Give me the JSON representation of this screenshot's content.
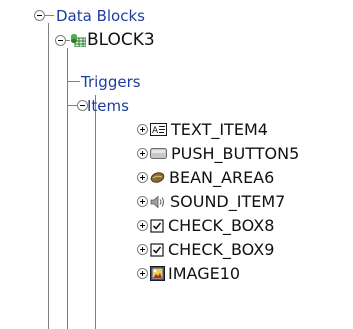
{
  "tree": {
    "data_blocks": "Data Blocks",
    "block": "BLOCK3",
    "triggers": "Triggers",
    "items_node": "Items",
    "items": [
      {
        "label": "TEXT_ITEM4",
        "icon": "text-item-icon"
      },
      {
        "label": "PUSH_BUTTON5",
        "icon": "push-button-icon"
      },
      {
        "label": "BEAN_AREA6",
        "icon": "bean-area-icon"
      },
      {
        "label": "SOUND_ITEM7",
        "icon": "sound-item-icon"
      },
      {
        "label": "CHECK_BOX8",
        "icon": "check-box-icon"
      },
      {
        "label": "CHECK_BOX9",
        "icon": "check-box-icon"
      },
      {
        "label": "IMAGE10",
        "icon": "image-item-icon"
      }
    ]
  },
  "colors": {
    "node_text": "#1c3ea0",
    "item_text": "#111111",
    "tree_line": "#808080"
  }
}
